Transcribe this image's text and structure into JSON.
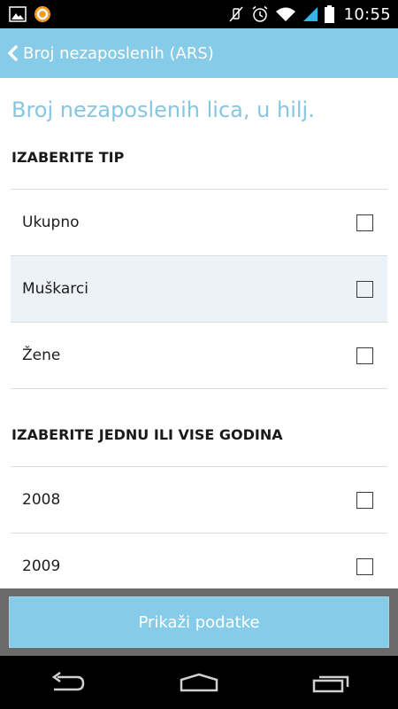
{
  "status_bar": {
    "time": "10:55",
    "icons": [
      "gallery-icon",
      "app-notification-icon",
      "mute-icon",
      "alarm-icon",
      "wifi-icon",
      "signal-icon",
      "battery-icon"
    ]
  },
  "action_bar": {
    "title": "Broj nezaposlenih (ARS)",
    "back_icon": "chevron-left-icon"
  },
  "main": {
    "heading": "Broj nezaposlenih lica, u hilj.",
    "type_section": {
      "label": "IZABERITE TIP",
      "items": [
        {
          "label": "Ukupno",
          "checked": false
        },
        {
          "label": "Muškarci",
          "checked": false
        },
        {
          "label": "Žene",
          "checked": false
        }
      ]
    },
    "year_section": {
      "label": "IZABERITE JEDNU ILI VISE GODINA",
      "items": [
        {
          "label": "2008",
          "checked": false
        },
        {
          "label": "2009",
          "checked": false
        }
      ]
    }
  },
  "footer": {
    "button_label": "Prikaži podatke"
  },
  "nav_bar": {
    "icons": [
      "back-icon",
      "home-icon",
      "recent-apps-icon"
    ]
  },
  "colors": {
    "accent": "#86cbe8",
    "heading": "#86c6e2",
    "alt_row": "#edf2f6",
    "footer_bg": "#6b6b6b"
  }
}
